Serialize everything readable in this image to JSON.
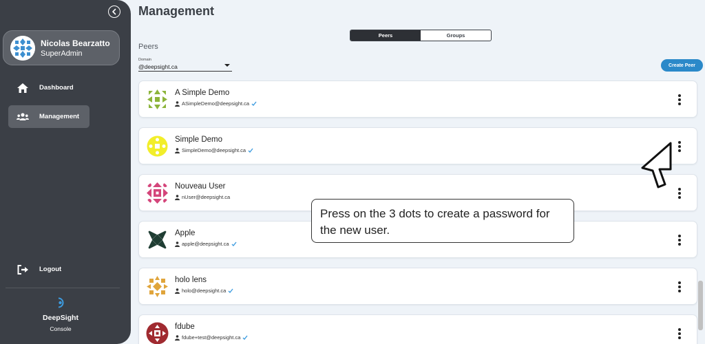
{
  "sidebar": {
    "user": {
      "name": "Nicolas Bearzatto",
      "role": "SuperAdmin"
    },
    "nav": [
      {
        "label": "Dashboard",
        "icon": "home-icon",
        "active": false
      },
      {
        "label": "Management",
        "icon": "users-icon",
        "active": true
      }
    ],
    "logout_label": "Logout",
    "brand": {
      "name": "DeepSight",
      "sub": "Console"
    }
  },
  "main": {
    "title": "Management",
    "tabs": [
      {
        "label": "Peers",
        "active": true
      },
      {
        "label": "Groups",
        "active": false
      }
    ],
    "section_label": "Peers",
    "domain": {
      "label": "Domain",
      "value": "@deepsight.ca"
    },
    "create_button": "Create Peer",
    "peers": [
      {
        "name": "A Simple Demo",
        "email": "ASimpleDemo@deepsight.ca",
        "verified": true,
        "avatar_color": "#8cb43a"
      },
      {
        "name": "Simple Demo",
        "email": "SimpleDemo@deepsight.ca",
        "verified": true,
        "avatar_color": "#f2ee2a"
      },
      {
        "name": "Nouveau User",
        "email": "nUser@deepsight.ca",
        "verified": false,
        "avatar_color": "#d4457a"
      },
      {
        "name": "Apple",
        "email": "apple@deepsight.ca",
        "verified": true,
        "avatar_color": "#1f3d33"
      },
      {
        "name": "holo lens",
        "email": "holo@deepsight.ca",
        "verified": true,
        "avatar_color": "#e0a53c"
      },
      {
        "name": "fdube",
        "email": "fdube+test@deepsight.ca",
        "verified": true,
        "avatar_color": "#a02a30"
      }
    ]
  },
  "tooltip": {
    "text": "Press on the 3 dots to create a password for the new user."
  },
  "colors": {
    "sidebar": "#3b3f46",
    "accent": "#2b89c9",
    "background": "#eef3f8"
  }
}
